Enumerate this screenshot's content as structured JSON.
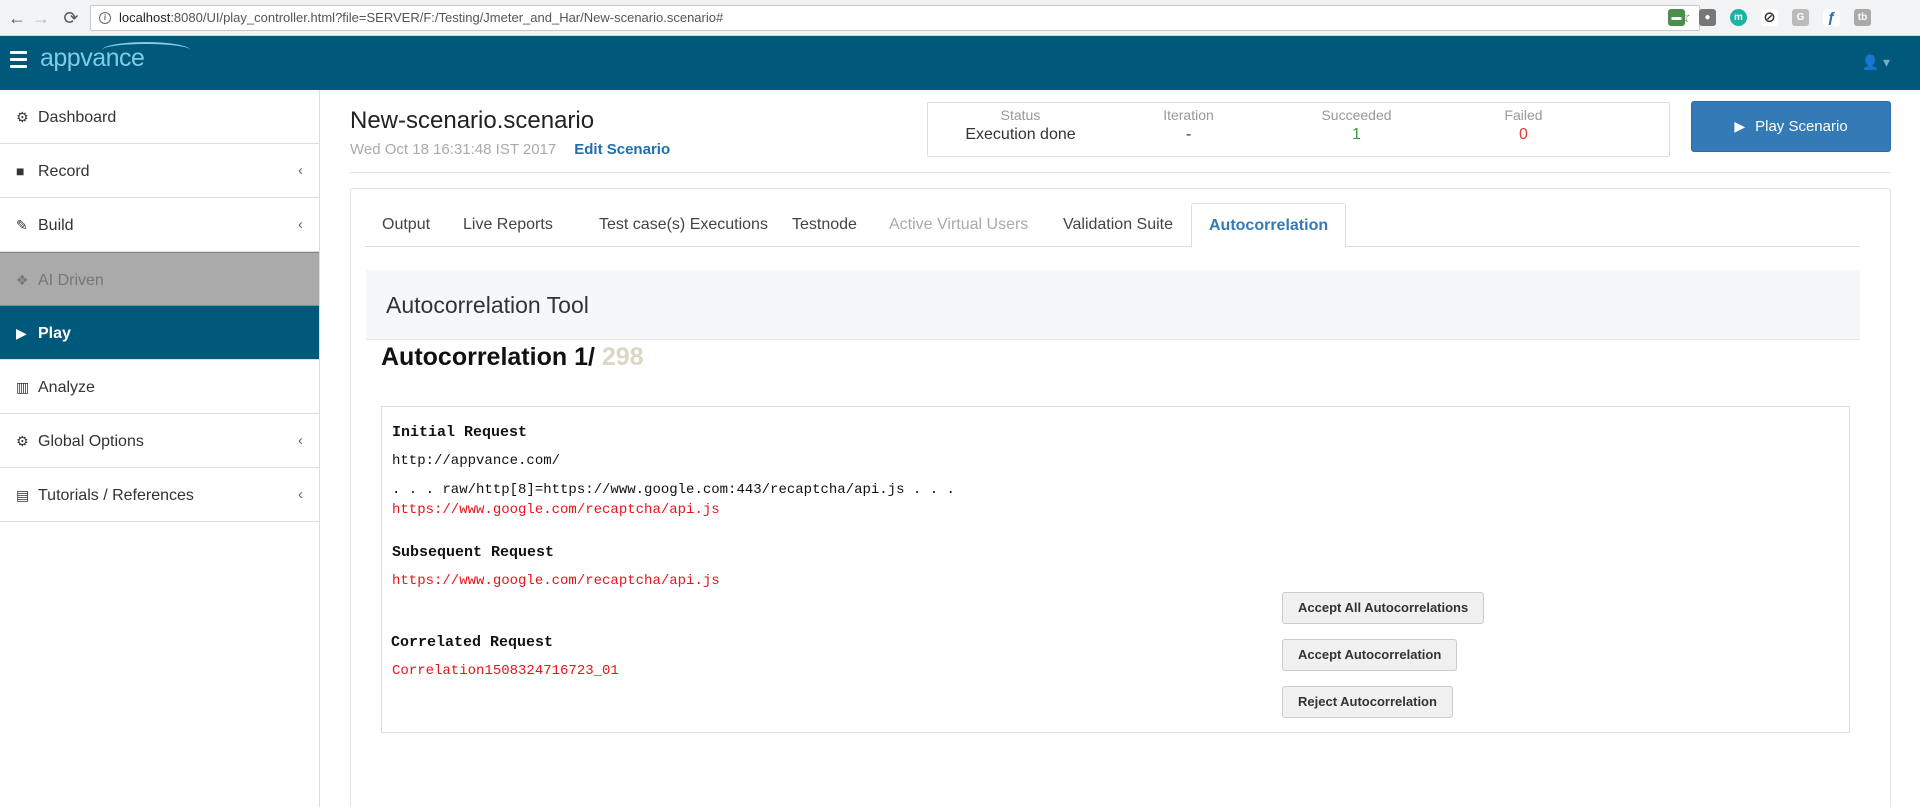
{
  "browser": {
    "url_host": "localhost",
    "url_rest": ":8080/UI/play_controller.html?file=SERVER/F:/Testing/Jmeter_and_Har/New-scenario.scenario#",
    "back": "←",
    "forward": "→",
    "reload": "⟳",
    "star": "☆",
    "extensions": [
      {
        "icon": "monitor-ext-icon",
        "glyph": "▬",
        "color": "#4a8f4a"
      },
      {
        "icon": "chat-ext-icon",
        "glyph": "●",
        "color": "#777777"
      },
      {
        "icon": "m-ext-icon",
        "glyph": "m",
        "color": "#1ab3a6"
      },
      {
        "icon": "block-ext-icon",
        "glyph": "⊘",
        "color": "#333333"
      },
      {
        "icon": "g-ext-icon",
        "glyph": "G",
        "color": "#bbbbbb"
      },
      {
        "icon": "feather-ext-icon",
        "glyph": "ƒ",
        "color": "#2a6ebb"
      },
      {
        "icon": "tb-ext-icon",
        "glyph": "tb",
        "color": "#aaaaaa"
      }
    ]
  },
  "header": {
    "logo": "appvance",
    "user_icon": "👤 ▾"
  },
  "sidebar": {
    "items": [
      {
        "label": "Dashboard",
        "icon": "⚙",
        "chevron": ""
      },
      {
        "label": "Record",
        "icon": "■",
        "chevron": "‹"
      },
      {
        "label": "Build",
        "icon": "✎",
        "chevron": "‹"
      },
      {
        "label": "AI Driven",
        "icon": "❖",
        "chevron": ""
      },
      {
        "label": "Play",
        "icon": "▶",
        "chevron": ""
      },
      {
        "label": "Analyze",
        "icon": "▥",
        "chevron": ""
      },
      {
        "label": "Global Options",
        "icon": "⚙",
        "chevron": "‹"
      },
      {
        "label": "Tutorials / References",
        "icon": "▤",
        "chevron": "‹"
      }
    ]
  },
  "main": {
    "title": "New-scenario.scenario",
    "date": "Wed Oct 18 16:31:48 IST 2017",
    "edit_label": "Edit Scenario",
    "status": [
      {
        "label": "Status",
        "value": "Execution done"
      },
      {
        "label": "Iteration",
        "value": "-"
      },
      {
        "label": "Succeeded",
        "value": "1"
      },
      {
        "label": "Failed",
        "value": "0"
      }
    ],
    "play_label": "Play Scenario",
    "tabs": [
      {
        "label": "Output"
      },
      {
        "label": "Live Reports"
      },
      {
        "label": "Test case(s) Executions"
      },
      {
        "label": "Testnode"
      },
      {
        "label": "Active Virtual Users"
      },
      {
        "label": "Validation Suite"
      },
      {
        "label": "Autocorrelation"
      }
    ]
  },
  "autocorrelation": {
    "tool_title": "Autocorrelation Tool",
    "heading": "Autocorrelation 1/",
    "total": " 298",
    "initial_request_label": "Initial Request",
    "initial_url": "http://appvance.com/",
    "raw_line": ". . . raw/http[8]=https://www.google.com:443/recaptcha/api.js . . .",
    "initial_match": "https://www.google.com/recaptcha/api.js",
    "subsequent_request_label": "Subsequent Request",
    "subsequent_url": "https://www.google.com/recaptcha/api.js",
    "correlated_request_label": "Correlated Request",
    "correlated_value": "Correlation1508324716723_01",
    "accept_all_label": "Accept All Autocorrelations",
    "accept_label": "Accept Autocorrelation",
    "reject_label": "Reject Autocorrelation"
  }
}
